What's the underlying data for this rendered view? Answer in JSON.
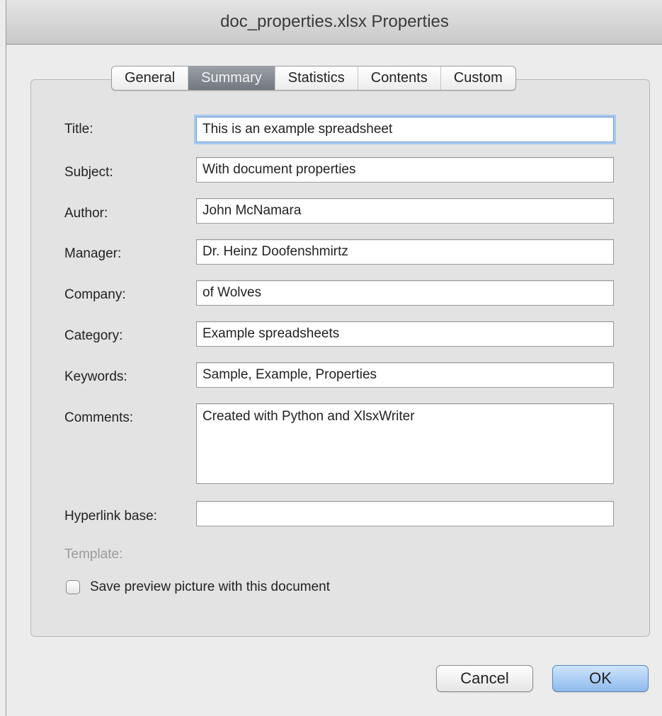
{
  "window": {
    "title": "doc_properties.xlsx Properties"
  },
  "tabs": [
    {
      "label": "General"
    },
    {
      "label": "Summary",
      "active": true
    },
    {
      "label": "Statistics"
    },
    {
      "label": "Contents"
    },
    {
      "label": "Custom"
    }
  ],
  "form": {
    "title": {
      "label": "Title:",
      "value": "This is an example spreadsheet"
    },
    "subject": {
      "label": "Subject:",
      "value": "With document properties"
    },
    "author": {
      "label": "Author:",
      "value": "John McNamara"
    },
    "manager": {
      "label": "Manager:",
      "value": "Dr. Heinz Doofenshmirtz"
    },
    "company": {
      "label": "Company:",
      "value": "of Wolves"
    },
    "category": {
      "label": "Category:",
      "value": "Example spreadsheets"
    },
    "keywords": {
      "label": "Keywords:",
      "value": "Sample, Example, Properties"
    },
    "comments": {
      "label": "Comments:",
      "value": "Created with Python and XlsxWriter"
    },
    "hyperlink_base": {
      "label": "Hyperlink base:",
      "value": ""
    },
    "template": {
      "label": "Template:"
    },
    "save_preview": {
      "label": "Save preview picture with this document",
      "checked": false
    }
  },
  "buttons": {
    "cancel": "Cancel",
    "ok": "OK"
  },
  "colors": {
    "default_button": "#8ebbed",
    "active_tab": "#71777f",
    "focus_ring": "#a9c9ee"
  }
}
